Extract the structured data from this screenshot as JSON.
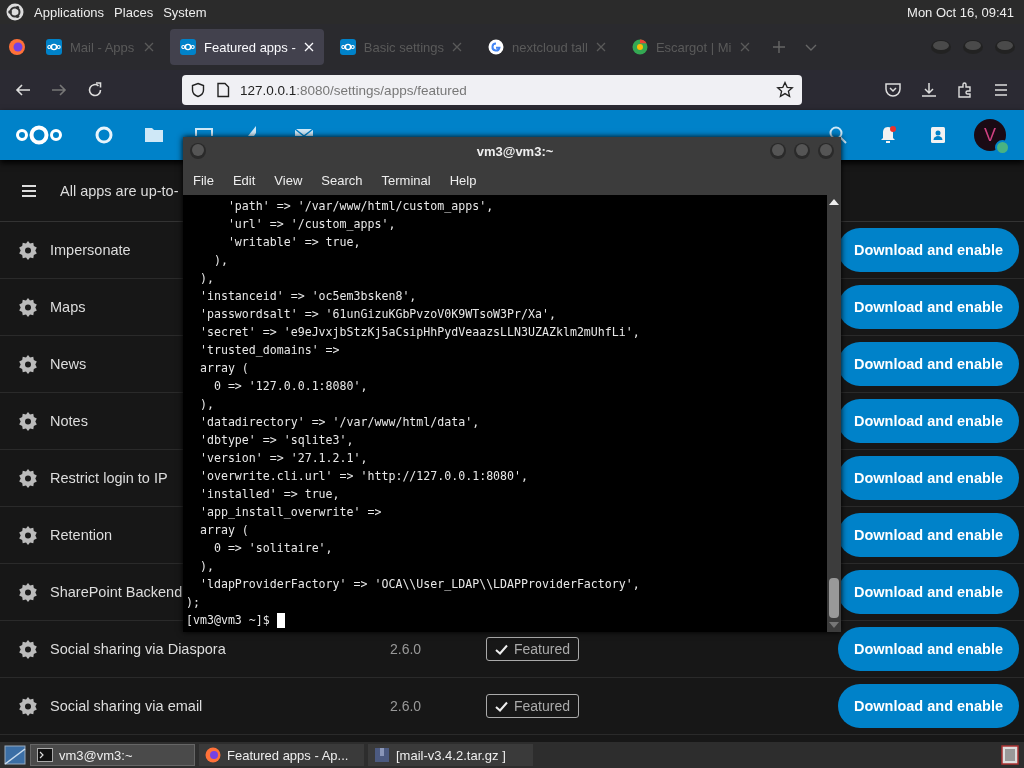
{
  "top_panel": {
    "menus": [
      "Applications",
      "Places",
      "System"
    ],
    "clock": "Mon Oct 16, 09:41"
  },
  "browser": {
    "tabs": [
      {
        "title": "Mail - Apps",
        "selected": false
      },
      {
        "title": "Featured apps -",
        "selected": true
      },
      {
        "title": "Basic settings",
        "selected": false
      },
      {
        "title": "nextcloud tall",
        "selected": false
      },
      {
        "title": "Escargot | Mi",
        "selected": false
      }
    ],
    "url_host": "127.0.0.1",
    "url_rest": ":8080/settings/apps/featured"
  },
  "nextcloud": {
    "avatar_letter": "V",
    "notice": "All apps are up-to-",
    "apps": [
      {
        "name": "Impersonate",
        "button": "Download and enable"
      },
      {
        "name": "Maps",
        "button": "Download and enable"
      },
      {
        "name": "News",
        "button": "Download and enable"
      },
      {
        "name": "Notes",
        "button": "Download and enable"
      },
      {
        "name": "Restrict login to IP",
        "button": "Download and enable"
      },
      {
        "name": "Retention",
        "button": "Download and enable"
      },
      {
        "name": "SharePoint Backend",
        "button": "Download and enable"
      },
      {
        "name": "Social sharing via Diaspora",
        "version": "2.6.0",
        "badge": "Featured",
        "button": "Download and enable"
      },
      {
        "name": "Social sharing via email",
        "version": "2.6.0",
        "badge": "Featured",
        "button": "Download and enable"
      }
    ]
  },
  "terminal": {
    "title": "vm3@vm3:~",
    "menus": [
      "File",
      "Edit",
      "View",
      "Search",
      "Terminal",
      "Help"
    ],
    "lines": [
      "      'path' => '/var/www/html/custom_apps',",
      "      'url' => '/custom_apps',",
      "      'writable' => true,",
      "    ),",
      "  ),",
      "  'instanceid' => 'oc5em3bsken8',",
      "  'passwordsalt' => '61unGizuKGbPvzoV0K9WTsoW3Pr/Xa',",
      "  'secret' => 'e9eJvxjbStzKj5aCsipHhPydVeaazsLLN3UZAZklm2mUhfLi',",
      "  'trusted_domains' =>",
      "  array (",
      "    0 => '127.0.0.1:8080',",
      "  ),",
      "  'datadirectory' => '/var/www/html/data',",
      "  'dbtype' => 'sqlite3',",
      "  'version' => '27.1.2.1',",
      "  'overwrite.cli.url' => 'http://127.0.0.1:8080',",
      "  'installed' => true,",
      "  'app_install_overwrite' =>",
      "  array (",
      "    0 => 'solitaire',",
      "  ),",
      "  'ldapProviderFactory' => 'OCA\\\\User_LDAP\\\\LDAPProviderFactory',",
      ");"
    ],
    "prompt": "[vm3@vm3 ~]$ "
  },
  "taskbar": {
    "items": [
      {
        "label": "vm3@vm3:~",
        "selected": true
      },
      {
        "label": "Featured apps - Ap...",
        "selected": false
      },
      {
        "label": "[mail-v3.4.2.tar.gz ]",
        "selected": false
      }
    ]
  }
}
